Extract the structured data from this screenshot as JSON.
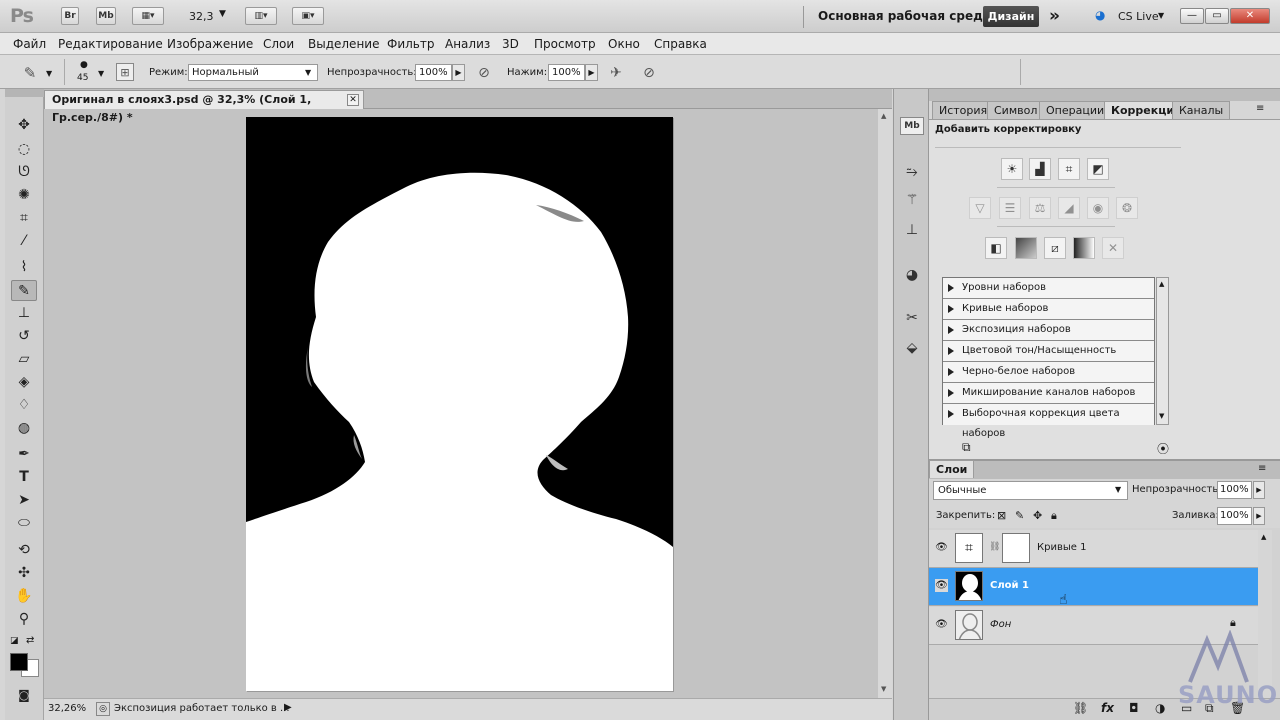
{
  "appbar": {
    "logo": "Ps",
    "bridge_btn": "Br",
    "minibridge_btn": "Mb",
    "zoom_value": "32,3",
    "workspace_name": "Основная рабочая среда",
    "workspace_button": "Дизайн",
    "more": "»",
    "cslive": "CS Live",
    "minimize": "—",
    "restore": "▭",
    "close": "✕"
  },
  "menu": [
    "Файл",
    "Редактирование",
    "Изображение",
    "Слои",
    "Выделение",
    "Фильтр",
    "Анализ",
    "3D",
    "Просмотр",
    "Окно",
    "Справка"
  ],
  "options": {
    "brush_size": "45",
    "mode_label": "Режим:",
    "mode_value": "Нормальный",
    "opacity_label": "Непрозрачность:",
    "opacity_value": "100%",
    "pressure_label": "Нажим:",
    "pressure_value": "100%"
  },
  "document": {
    "tab_title": "Оригинал в слоях3.psd @ 32,3% (Слой 1, Гр.сер./8#) *",
    "close": "✕",
    "zoom_status": "32,26%",
    "status_text": "Экспозиция работает только в ..."
  },
  "panels": {
    "tabs": [
      "История",
      "Символ",
      "Операции",
      "Коррекция",
      "Каналы"
    ],
    "active_tab": "Коррекция",
    "adjust_header": "Добавить корректировку",
    "presets": [
      "Уровни наборов",
      "Кривые наборов",
      "Экспозиция наборов",
      "Цветовой тон/Насыщенность наборов",
      "Черно-белое наборов",
      "Микширование каналов наборов",
      "Выборочная коррекция цвета наборов"
    ]
  },
  "layers": {
    "tab": "Слои",
    "blend_mode": "Обычные",
    "opacity_label": "Непрозрачность:",
    "opacity_value": "100%",
    "lock_label": "Закрепить:",
    "fill_label": "Заливка:",
    "fill_value": "100%",
    "rows": [
      {
        "name": "Кривые 1"
      },
      {
        "name": "Слой 1"
      },
      {
        "name": "Фон"
      }
    ],
    "selected": "Слой 1"
  },
  "watermark": "SAUNO",
  "colors": {
    "selection": "#3a9cf1",
    "foreground": "#000000",
    "background": "#ffffff"
  }
}
